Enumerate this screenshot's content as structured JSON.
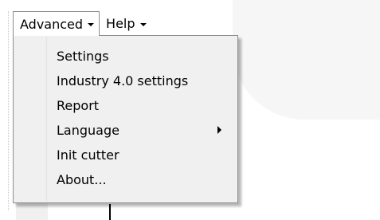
{
  "menubar": {
    "items": [
      {
        "label": "Advanced",
        "icon": "chevron-down-icon",
        "open": true
      },
      {
        "label": "Help",
        "icon": "chevron-down-icon",
        "open": false
      }
    ]
  },
  "dropdown": {
    "items": [
      {
        "label": "Settings",
        "has_submenu": false
      },
      {
        "label": "Industry 4.0 settings",
        "has_submenu": false
      },
      {
        "label": "Report",
        "has_submenu": false
      },
      {
        "label": "Language",
        "has_submenu": true
      },
      {
        "label": "Init cutter",
        "has_submenu": false
      },
      {
        "label": "About...",
        "has_submenu": false
      }
    ]
  }
}
